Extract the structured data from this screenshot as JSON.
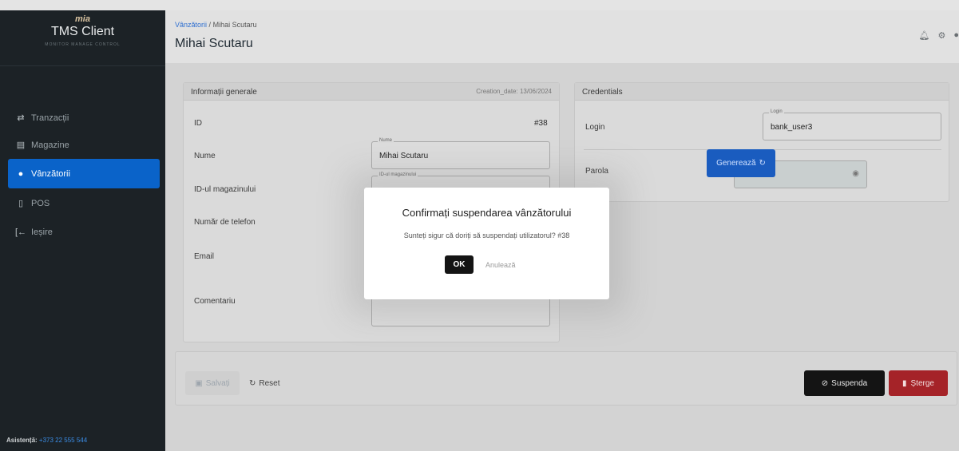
{
  "sidebar": {
    "logo": "mia",
    "app_title": "TMS Client",
    "tagline": "MONITOR MANAGE CONTROL",
    "items": [
      {
        "label": "Tranzacții",
        "icon": "transfer-icon"
      },
      {
        "label": "Magazine",
        "icon": "store-icon"
      },
      {
        "label": "Vânzătorii",
        "icon": "user-icon"
      },
      {
        "label": "POS",
        "icon": "pos-terminal-icon"
      },
      {
        "label": "Ieșire",
        "icon": "logout-icon"
      }
    ],
    "active_index": 2,
    "support_label": "Asistență:",
    "support_phone": "+373 22 555 544"
  },
  "header": {
    "breadcrumb_link": "Vânzătorii",
    "breadcrumb_sep": "/",
    "breadcrumb_current": "Mihai Scutaru",
    "title": "Mihai Scutaru"
  },
  "general": {
    "title": "Informații generale",
    "creation_date": "Creation_date: 13/06/2024",
    "id_label": "ID",
    "id_value": "#38",
    "name_label": "Nume",
    "name_field_label": "Nume",
    "name_value": "Mihai Scutaru",
    "store_label": "ID-ul magazinului",
    "store_field_label": "ID-ul magazinului",
    "phone_label": "Număr de telefon",
    "email_label": "Email",
    "comment_label": "Comentariu"
  },
  "credentials": {
    "title": "Credentials",
    "login_label": "Login",
    "login_field_label": "Login",
    "login_value": "bank_user3",
    "password_label": "Parola",
    "password_value": "••••",
    "generate_label": "Generează"
  },
  "actions": {
    "save": "Salvați",
    "reset": "Reset",
    "suspend": "Suspenda",
    "delete": "Șterge"
  },
  "modal": {
    "title": "Confirmați suspendarea vânzătorului",
    "text": "Sunteți sigur că doriți să suspendați utilizatorul? #38",
    "ok": "OK",
    "cancel": "Anulează"
  }
}
